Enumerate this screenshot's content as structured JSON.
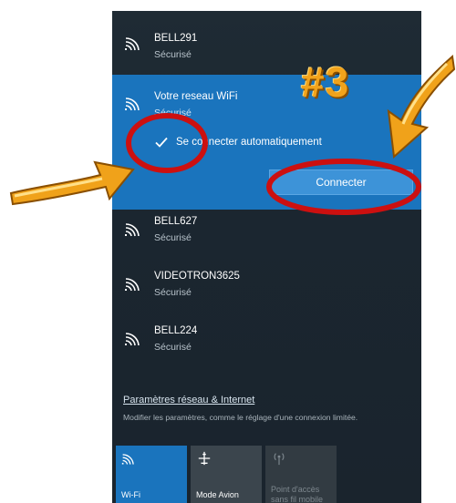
{
  "networks": [
    {
      "name": "BELL291",
      "status": "Sécurisé"
    },
    {
      "name": "Votre reseau WiFi",
      "status": "Sécurisé"
    },
    {
      "name": "BELL627",
      "status": "Sécurisé"
    },
    {
      "name": "VIDEOTRON3625",
      "status": "Sécurisé"
    },
    {
      "name": "BELL224",
      "status": "Sécurisé"
    }
  ],
  "selected": {
    "auto_connect_label": "Se connecter automatiquement",
    "auto_connect_checked": true,
    "connect_button": "Connecter"
  },
  "settings": {
    "link": "Paramètres réseau & Internet",
    "description": "Modifier les paramètres, comme le réglage d'une connexion limitée."
  },
  "quick_actions": {
    "wifi": {
      "label": "Wi-Fi",
      "active": true,
      "icon": "wifi-icon"
    },
    "avion": {
      "label": "Mode Avion",
      "active": false,
      "icon": "airplane-icon"
    },
    "hotspot": {
      "label": "Point d'accès sans fil mobile",
      "label_line1": "Point d'accès",
      "label_line2": "sans fil mobile",
      "active": false,
      "icon": "hotspot-icon"
    }
  },
  "annotation": {
    "step": "#3",
    "colors": {
      "circle": "#cc1010",
      "arrow": "#f0a21a",
      "accent": "#1a74bd"
    }
  }
}
